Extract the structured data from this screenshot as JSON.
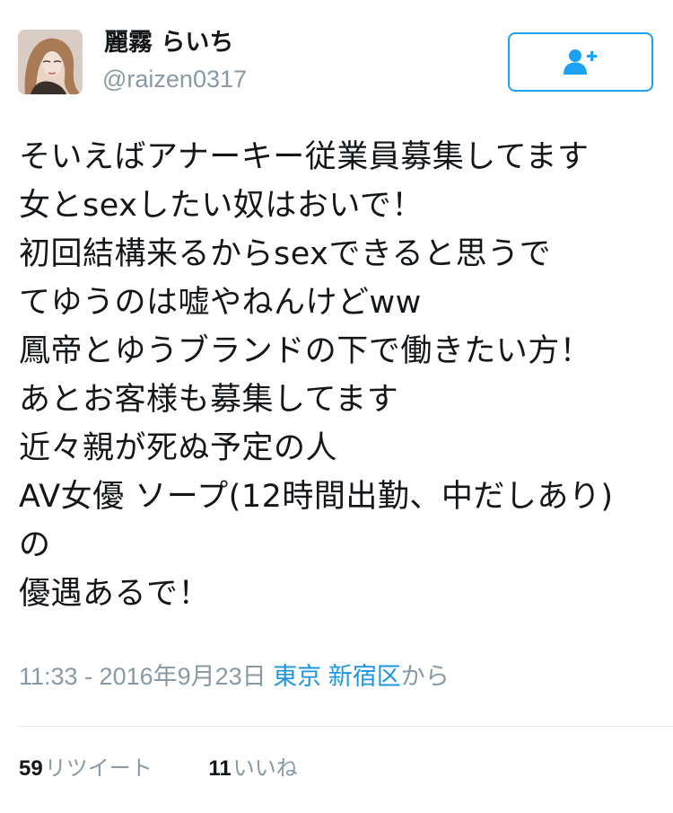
{
  "user": {
    "display_name": "麗霧 らいち",
    "handle": "@raizen0317"
  },
  "follow_button": {
    "icon": "add-user-icon",
    "color": "#1da1f2"
  },
  "tweet": {
    "lines": [
      "そいえばアナーキー従業員募集してます",
      "女とsexしたい奴はおいで！",
      "初回結構来るからsexできると思うで",
      "てゆうのは嘘やねんけどww",
      "鳳帝とゆうブランドの下で働きたい方！",
      "あとお客様も募集してます",
      "近々親が死ぬ予定の人",
      "AV女優 ソープ(12時間出勤、中だしあり)",
      "の",
      "優遇あるで！"
    ]
  },
  "meta": {
    "timestamp": "11:33 - 2016年9月23日",
    "place": "東京 新宿区",
    "suffix": "から"
  },
  "stats": {
    "retweets_count": "59",
    "retweets_label": "リツイート",
    "likes_count": "11",
    "likes_label": "いいね"
  },
  "colors": {
    "accent": "#1da1f2",
    "link": "#1b95e0",
    "muted": "#8899a6",
    "text": "#14171a"
  }
}
